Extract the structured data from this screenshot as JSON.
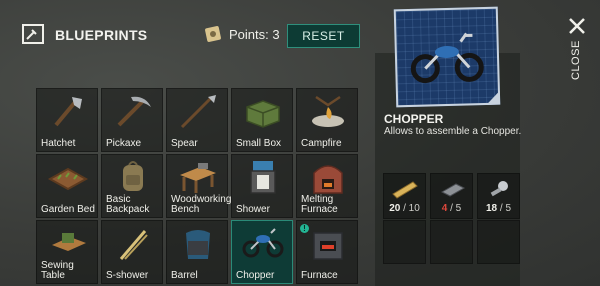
{
  "header": {
    "title": "BLUEPRINTS",
    "points_label": "Points: 3",
    "reset_label": "RESET"
  },
  "grid": {
    "items": [
      {
        "label": "Hatchet"
      },
      {
        "label": "Pickaxe"
      },
      {
        "label": "Spear"
      },
      {
        "label": "Small Box"
      },
      {
        "label": "Campfire"
      },
      {
        "label": "Garden Bed"
      },
      {
        "label": "Basic\nBackpack"
      },
      {
        "label": "Woodworking\nBench"
      },
      {
        "label": "Shower"
      },
      {
        "label": "Melting\nFurnace"
      },
      {
        "label": "Sewing Table"
      },
      {
        "label": "S-shower"
      },
      {
        "label": "Barrel"
      },
      {
        "label": "Chopper",
        "selected": true
      },
      {
        "label": "Furnace",
        "new": true
      }
    ]
  },
  "detail": {
    "title": "CHOPPER",
    "description": "Allows to assemble a Chopper.",
    "requirements": [
      {
        "icon": "wood-plank-icon",
        "have": "20",
        "need": "/ 10",
        "enough": true
      },
      {
        "icon": "iron-bar-icon",
        "have": "4",
        "need": "/ 5",
        "enough": false
      },
      {
        "icon": "bolt-nut-icon",
        "have": "18",
        "need": "/ 5",
        "enough": true
      }
    ]
  },
  "close_label": "CLOSE",
  "colors": {
    "accent": "#2a8a78",
    "selected_bg": "#0e3b36",
    "insufficient": "#e0473c"
  }
}
